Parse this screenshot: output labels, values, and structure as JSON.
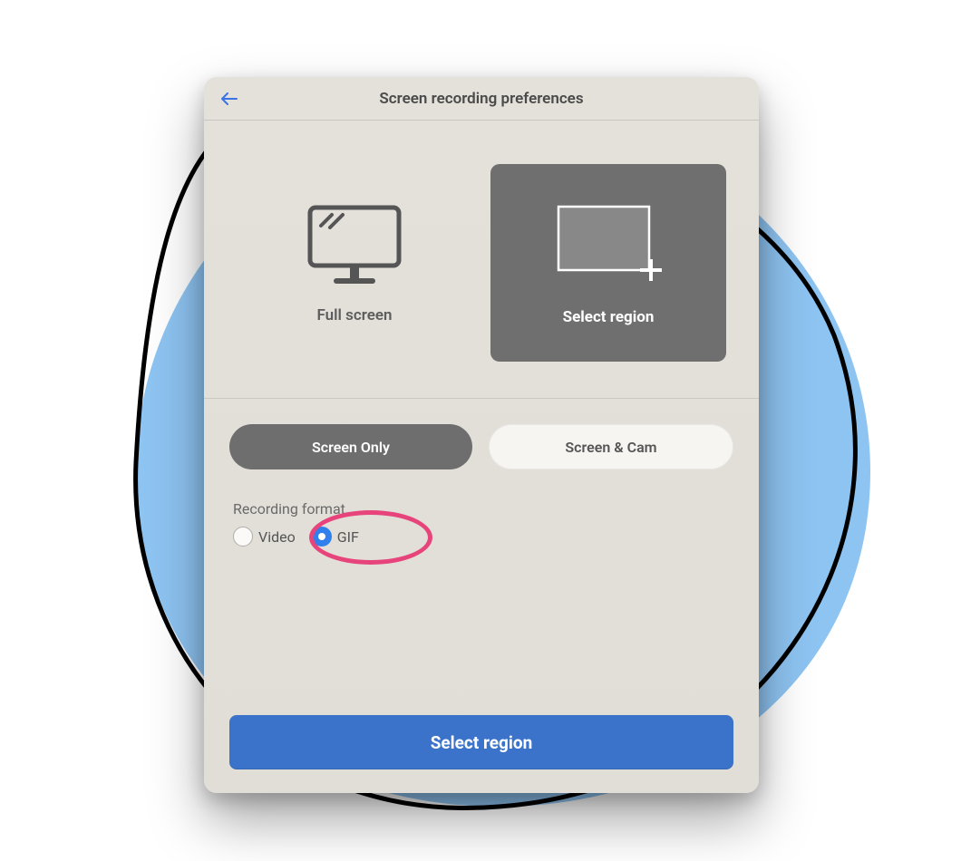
{
  "header": {
    "title": "Screen recording preferences"
  },
  "modes": {
    "full_screen": {
      "label": "Full screen",
      "selected": false
    },
    "select_region": {
      "label": "Select region",
      "selected": true
    }
  },
  "source": {
    "screen_only": {
      "label": "Screen Only",
      "selected": true
    },
    "screen_cam": {
      "label": "Screen & Cam",
      "selected": false
    }
  },
  "format": {
    "section_label": "Recording format",
    "video": {
      "label": "Video",
      "selected": false
    },
    "gif": {
      "label": "GIF",
      "selected": true
    }
  },
  "primary_action": {
    "label": "Select region"
  },
  "annotation": {
    "highlight_target": "gif-radio"
  }
}
